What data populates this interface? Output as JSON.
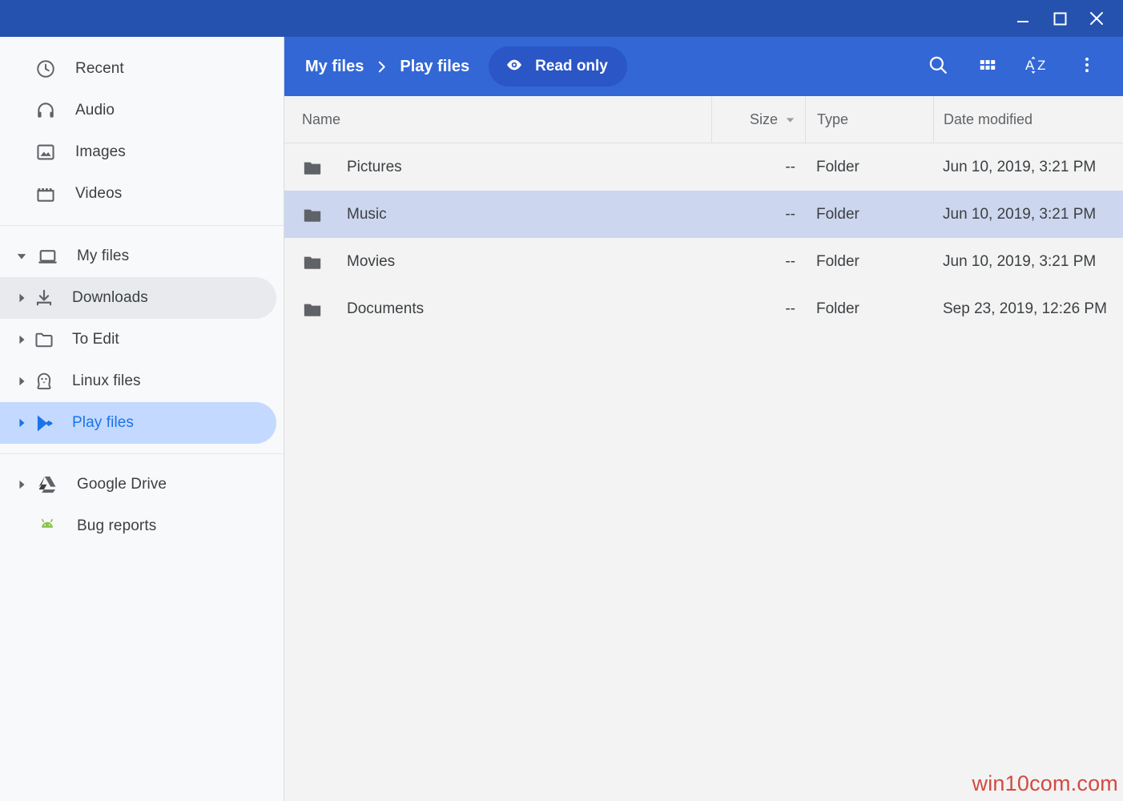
{
  "window": {
    "controls": [
      {
        "name": "minimize",
        "label": "Minimize"
      },
      {
        "name": "maximize",
        "label": "Maximize"
      },
      {
        "name": "close",
        "label": "Close"
      }
    ],
    "titlebar_color": "#2552ae"
  },
  "sidebar": {
    "sections": [
      {
        "items": [
          {
            "label": "Recent",
            "icon": "clock-icon",
            "state": "normal"
          },
          {
            "label": "Audio",
            "icon": "headphones-icon",
            "state": "normal"
          },
          {
            "label": "Images",
            "icon": "image-icon",
            "state": "normal"
          },
          {
            "label": "Videos",
            "icon": "video-icon",
            "state": "normal"
          }
        ]
      },
      {
        "items": [
          {
            "label": "My files",
            "icon": "laptop-icon",
            "state": "expanded"
          },
          {
            "label": "Downloads",
            "icon": "download-icon",
            "state": "hovered"
          },
          {
            "label": "To Edit",
            "icon": "folder-icon",
            "state": "normal"
          },
          {
            "label": "Linux files",
            "icon": "linux-penguin-icon",
            "state": "normal"
          },
          {
            "label": "Play files",
            "icon": "google-play-icon",
            "state": "selected"
          }
        ]
      },
      {
        "items": [
          {
            "label": "Google Drive",
            "icon": "google-drive-icon",
            "state": "normal"
          },
          {
            "label": "Bug reports",
            "icon": "android-icon",
            "state": "normal"
          }
        ]
      }
    ]
  },
  "toolbar": {
    "breadcrumb": [
      {
        "label": "My files"
      },
      {
        "label": "Play files"
      }
    ],
    "separator": "chevron-right-icon",
    "read_only": {
      "label": "Read only",
      "icon": "eye-icon"
    },
    "actions": [
      {
        "name": "search",
        "icon": "search-icon"
      },
      {
        "name": "view-grid",
        "icon": "grid-view-icon"
      },
      {
        "name": "sort",
        "icon": "sort-az-icon"
      },
      {
        "name": "more",
        "icon": "more-vertical-icon"
      }
    ],
    "accent_color": "#3367d6"
  },
  "table": {
    "columns": [
      {
        "key": "name",
        "label": "Name",
        "sorted": false
      },
      {
        "key": "size",
        "label": "Size",
        "sorted": true,
        "direction": "desc"
      },
      {
        "key": "type",
        "label": "Type",
        "sorted": false
      },
      {
        "key": "date",
        "label": "Date modified",
        "sorted": false
      }
    ],
    "rows": [
      {
        "name": "Pictures",
        "size": "--",
        "type": "Folder",
        "date": "Jun 10, 2019, 3:21 PM",
        "icon": "folder-icon",
        "selected": false
      },
      {
        "name": "Music",
        "size": "--",
        "type": "Folder",
        "date": "Jun 10, 2019, 3:21 PM",
        "icon": "folder-icon",
        "selected": true
      },
      {
        "name": "Movies",
        "size": "--",
        "type": "Folder",
        "date": "Jun 10, 2019, 3:21 PM",
        "icon": "folder-icon",
        "selected": false
      },
      {
        "name": "Documents",
        "size": "--",
        "type": "Folder",
        "date": "Sep 23, 2019, 12:26 PM",
        "icon": "folder-icon",
        "selected": false
      }
    ],
    "selection_color": "#ccd6ee"
  },
  "watermark": {
    "text": "win10com.com",
    "color": "#d24a43"
  }
}
